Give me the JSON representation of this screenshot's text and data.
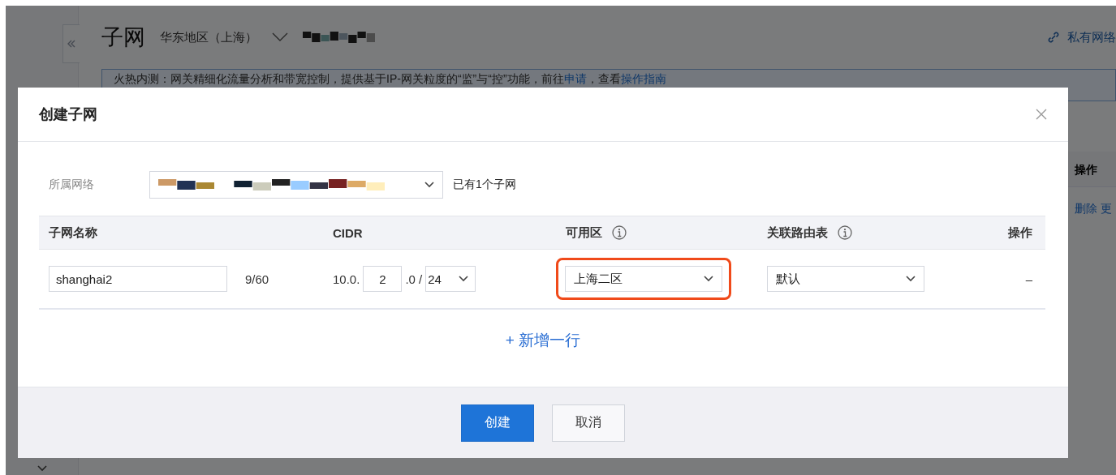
{
  "page": {
    "title": "子网",
    "region": "华东地区（上海）",
    "link": "私有网络",
    "notice": {
      "text": "火热内测：网关精细化流量分析和带宽控制，提供基于IP-网关粒度的“监”与“控”功能，前往",
      "apply_link": "申请",
      "middle": "，查看",
      "guide_link": "操作指南"
    },
    "table": {
      "header": "操作",
      "action": "删除",
      "action_2": "更"
    }
  },
  "dialog": {
    "title": "创建子网",
    "network": {
      "label": "所属网络",
      "note": "已有1个子网"
    },
    "columns": [
      {
        "label": "子网名称",
        "info": false
      },
      {
        "label": "CIDR",
        "info": false
      },
      {
        "label": "可用区",
        "info": true
      },
      {
        "label": "关联路由表",
        "info": true
      },
      {
        "label": "操作",
        "info": false
      }
    ],
    "rows": [
      {
        "name": "shanghai2",
        "count": "9/60",
        "cidr_prefix": "10.0.",
        "cidr_octet": "2",
        "cidr_mid": ".0 /",
        "mask": "24",
        "zone": "上海二区",
        "zone_highlighted": true,
        "route_table": "默认",
        "action": "–"
      }
    ],
    "add_row": "+ 新增一行",
    "buttons": [
      {
        "label": "创建",
        "kind": "primary"
      },
      {
        "label": "取消",
        "kind": "default"
      }
    ]
  }
}
